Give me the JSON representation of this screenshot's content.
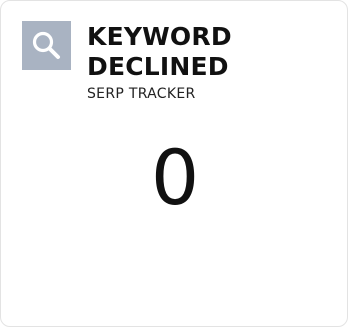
{
  "widget": {
    "title_line1": "KEYWORD",
    "title_line2": "DECLINED",
    "subtitle": "SERP TRACKER",
    "value": "0",
    "icon": "search-icon",
    "icon_background": "#a9b3c2"
  }
}
